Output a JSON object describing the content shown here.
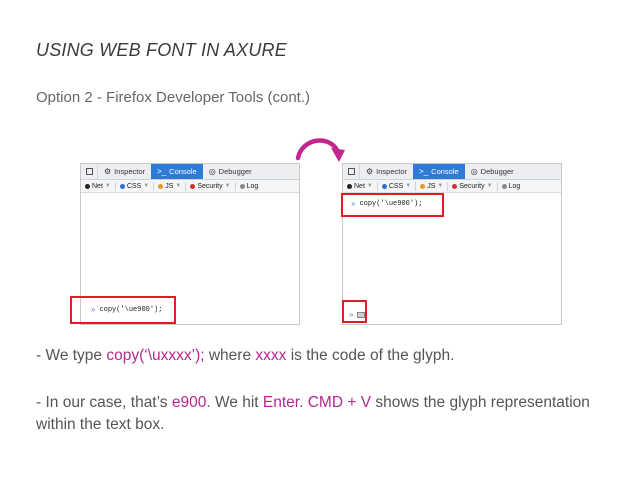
{
  "slide": {
    "title": "USING WEB FONT IN AXURE",
    "subtitle": "Option 2 - Firefox Developer Tools (cont.)"
  },
  "devtools": {
    "tabs": [
      "Inspector",
      "Console",
      "Debugger"
    ],
    "active_tab": "Console",
    "filters": [
      "Net",
      "CSS",
      "JS",
      "Security",
      "Log"
    ],
    "colors": {
      "accent": "#2d7bd6",
      "highlight": "#e01b24",
      "arrow": "#c2268f"
    }
  },
  "left_panel": {
    "prompt": "»",
    "input_value": "copy('\\ue900');"
  },
  "right_panel": {
    "prompt": "»",
    "history_value": "copy('\\ue900');",
    "input_prompt": "»",
    "pasted_glyph": "glyph-box-icon"
  },
  "paragraph1": {
    "t1": "- We type ",
    "t2": "copy(‘\\uxxxx’);",
    "t3": " where ",
    "t4": "xxxx",
    "t5": " is the code of the glyph."
  },
  "paragraph2": {
    "t1": "- In our case, that’s ",
    "t2": "e900",
    "t3": ". We hit ",
    "t4": "Enter",
    "t5": ". ",
    "t6": "CMD + V",
    "t7": " shows the glyph representation within the text box."
  }
}
